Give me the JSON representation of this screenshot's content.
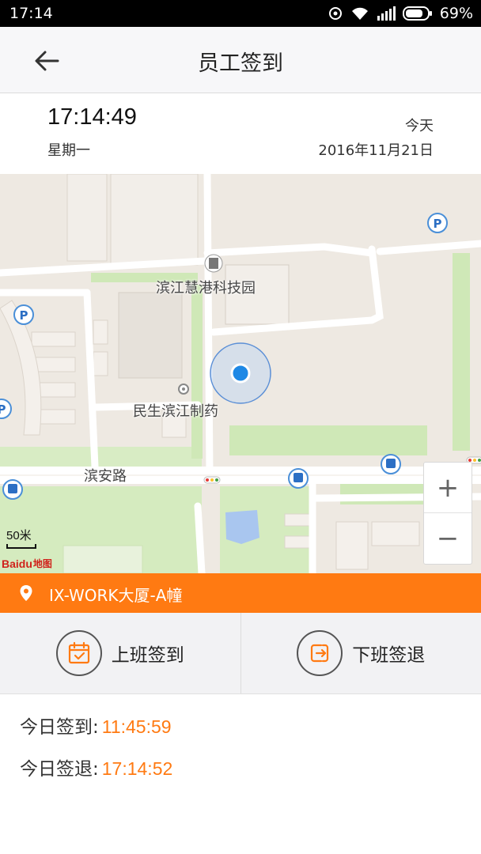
{
  "status_bar": {
    "time": "17:14",
    "battery": "69%"
  },
  "header": {
    "title": "员工签到"
  },
  "clock": {
    "time": "17:14:49",
    "weekday": "星期一",
    "today_label": "今天",
    "date": "2016年11月21日"
  },
  "map": {
    "labels": {
      "park": "滨江慧港科技园",
      "pharma": "民生滨江制药",
      "road": "滨安路"
    },
    "scale": "50米",
    "logo_text": "Baidu",
    "logo_map": "地图",
    "zoom_in": "+",
    "zoom_out": "−"
  },
  "location": {
    "name": "IX-WORK大厦-A幢"
  },
  "actions": {
    "check_in": "上班签到",
    "check_out": "下班签退"
  },
  "records": {
    "check_in_label": "今日签到:",
    "check_in_time": "11:45:59",
    "check_out_label": "今日签退:",
    "check_out_time": "17:14:52"
  },
  "colors": {
    "accent": "#ff7a12",
    "location_dot": "#1e88e5"
  }
}
